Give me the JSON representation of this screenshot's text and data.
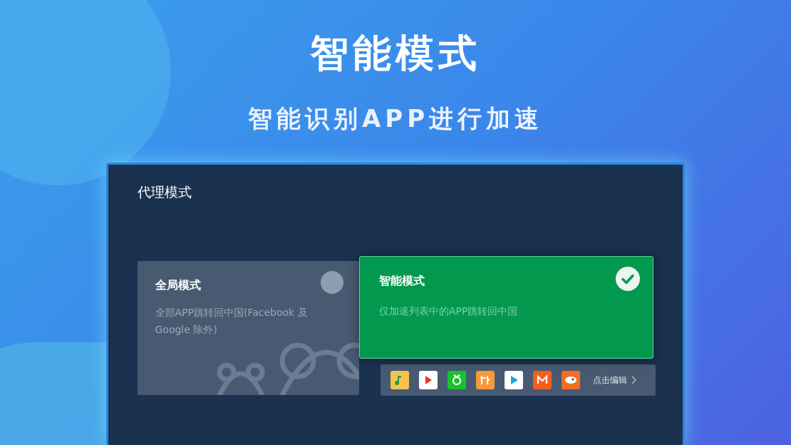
{
  "headline": "智能模式",
  "subheadline": "智能识别APP进行加速",
  "panel": {
    "title": "代理模式",
    "modes": [
      {
        "title": "全局模式",
        "description": "全部APP跳转回中国(Facebook 及 Google 除外)",
        "selected": false
      },
      {
        "title": "智能模式",
        "description": "仅加速列表中的APP跳转回中国",
        "selected": true
      }
    ],
    "apps": [
      {
        "color": "#f5c24c"
      },
      {
        "color": "#ffffff"
      },
      {
        "color": "#19c12f"
      },
      {
        "color": "#f7993b"
      },
      {
        "color": "#ffffff"
      },
      {
        "color": "#f2601c"
      },
      {
        "color": "#f26f23"
      }
    ],
    "edit_link": "点击编辑"
  }
}
